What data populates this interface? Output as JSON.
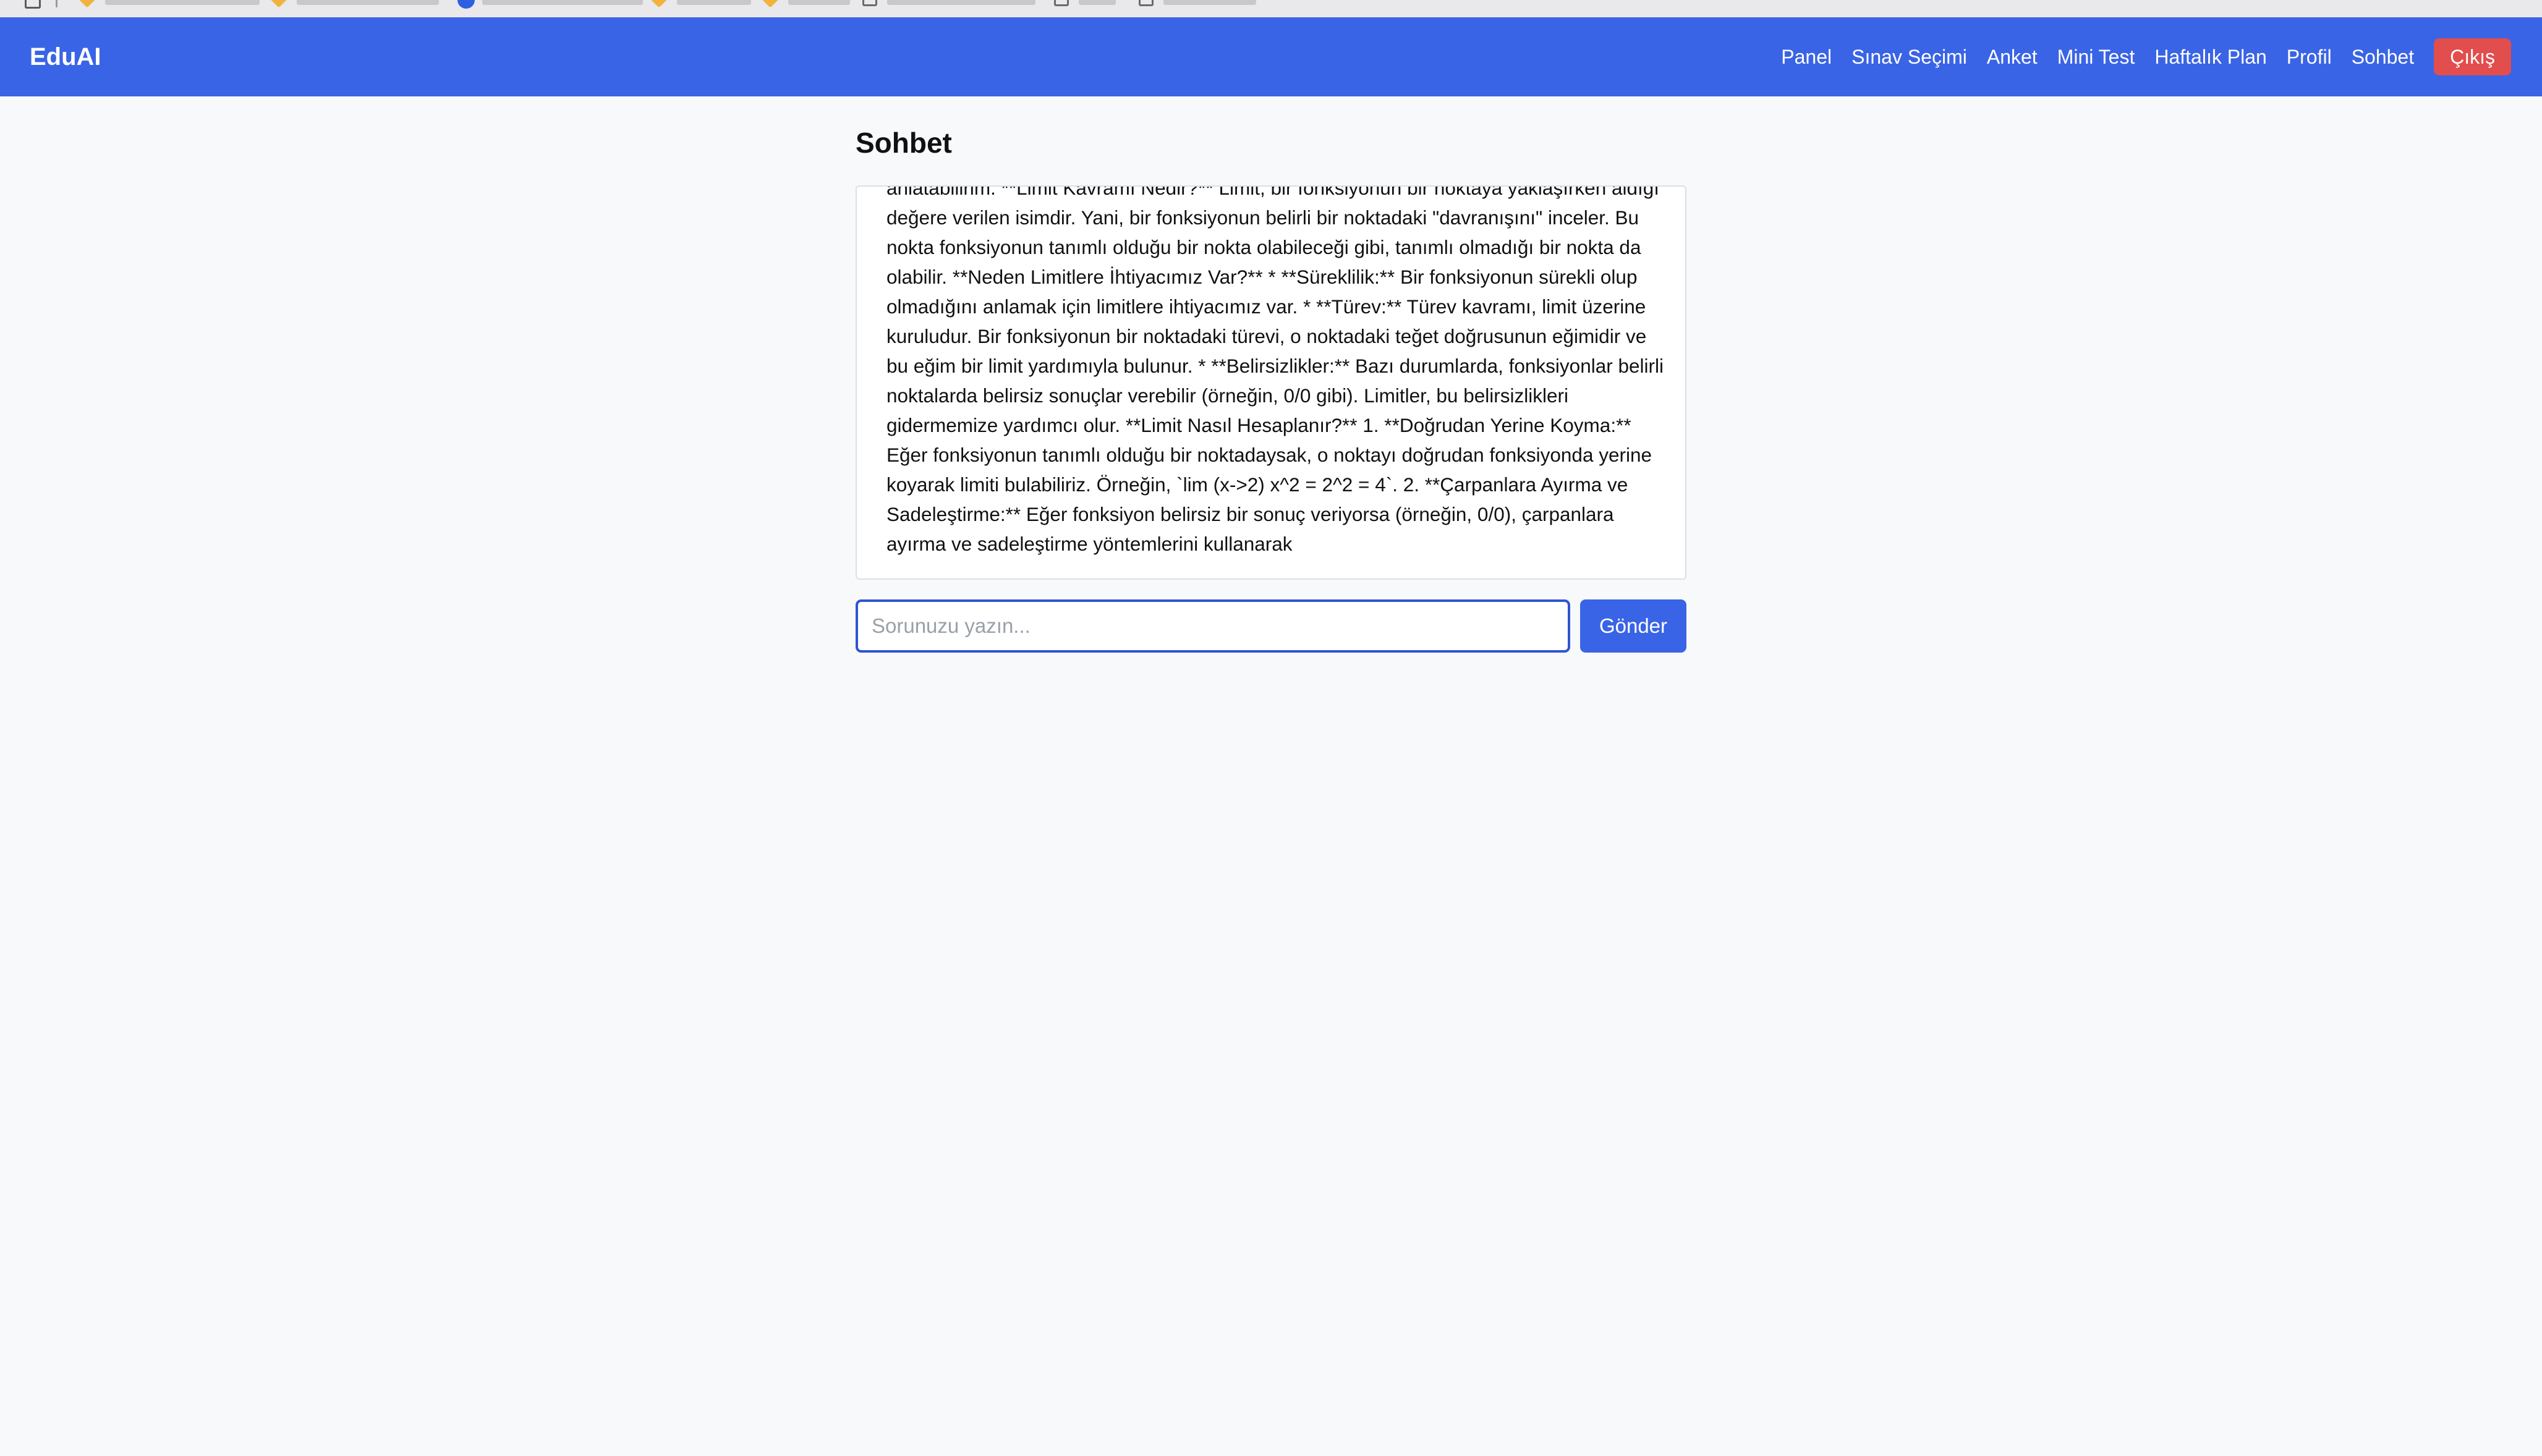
{
  "navbar": {
    "brand": "EduAI",
    "links": [
      "Panel",
      "Sınav Seçimi",
      "Anket",
      "Mini Test",
      "Haftalık Plan",
      "Profil",
      "Sohbet"
    ],
    "logout_label": "Çıkış"
  },
  "main": {
    "title": "Sohbet",
    "chat_message": "anlatabilirim. **Limit Kavramı Nedir?** Limit, bir fonksiyonun bir noktaya yaklaşırken aldığı değere verilen isimdir. Yani, bir fonksiyonun belirli bir noktadaki \"davranışını\" inceler. Bu nokta fonksiyonun tanımlı olduğu bir nokta olabileceği gibi, tanımlı olmadığı bir nokta da olabilir. **Neden Limitlere İhtiyacımız Var?** * **Süreklilik:** Bir fonksiyonun sürekli olup olmadığını anlamak için limitlere ihtiyacımız var. * **Türev:** Türev kavramı, limit üzerine kuruludur. Bir fonksiyonun bir noktadaki türevi, o noktadaki teğet doğrusunun eğimidir ve bu eğim bir limit yardımıyla bulunur. * **Belirsizlikler:** Bazı durumlarda, fonksiyonlar belirli noktalarda belirsiz sonuçlar verebilir (örneğin, 0/0 gibi). Limitler, bu belirsizlikleri gidermemize yardımcı olur. **Limit Nasıl Hesaplanır?** 1. **Doğrudan Yerine Koyma:** Eğer fonksiyonun tanımlı olduğu bir noktadaysak, o noktayı doğrudan fonksiyonda yerine koyarak limiti bulabiliriz. Örneğin, `lim (x->2) x^2 = 2^2 = 4`. 2. **Çarpanlara Ayırma ve Sadeleştirme:** Eğer fonksiyon belirsiz bir sonuç veriyorsa (örneğin, 0/0), çarpanlara ayırma ve sadeleştirme yöntemlerini kullanarak",
    "input_placeholder": "Sorunuzu yazın...",
    "input_value": "",
    "send_label": "Gönder"
  },
  "colors": {
    "navbar_bg": "#3a64e6",
    "logout_bg": "#e24d4d",
    "page_bg": "#f8f9fb",
    "input_focus_border": "#2e56cf"
  }
}
